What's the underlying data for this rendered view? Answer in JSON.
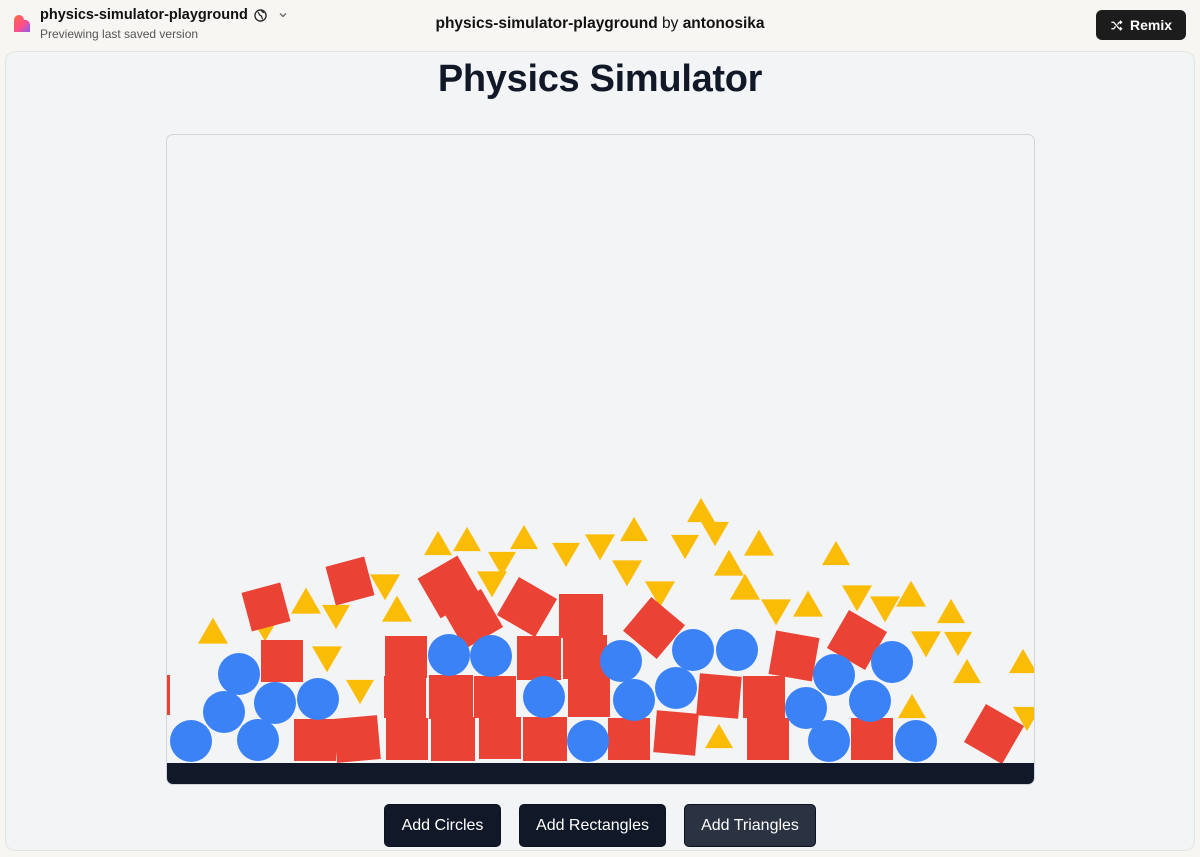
{
  "header": {
    "project_name": "physics-simulator-playground",
    "subtitle": "Previewing last saved version",
    "center_project": "physics-simulator-playground",
    "center_by": "by",
    "center_author": "antonosika",
    "remix_label": "Remix",
    "icons": {
      "logo": "lovable-heart-logo",
      "visibility": "globe-icon",
      "menu": "chevron-down-icon",
      "remix": "shuffle-icon"
    }
  },
  "app": {
    "title": "Physics Simulator",
    "buttons": {
      "add_circles": "Add Circles",
      "add_rectangles": "Add Rectangles",
      "add_triangles": "Add Triangles"
    }
  },
  "colors": {
    "circle": "#3b82f6",
    "rectangle": "#ea4335",
    "triangle": "#fbbc05",
    "ground": "#111827",
    "background": "#f3f4f6"
  }
}
